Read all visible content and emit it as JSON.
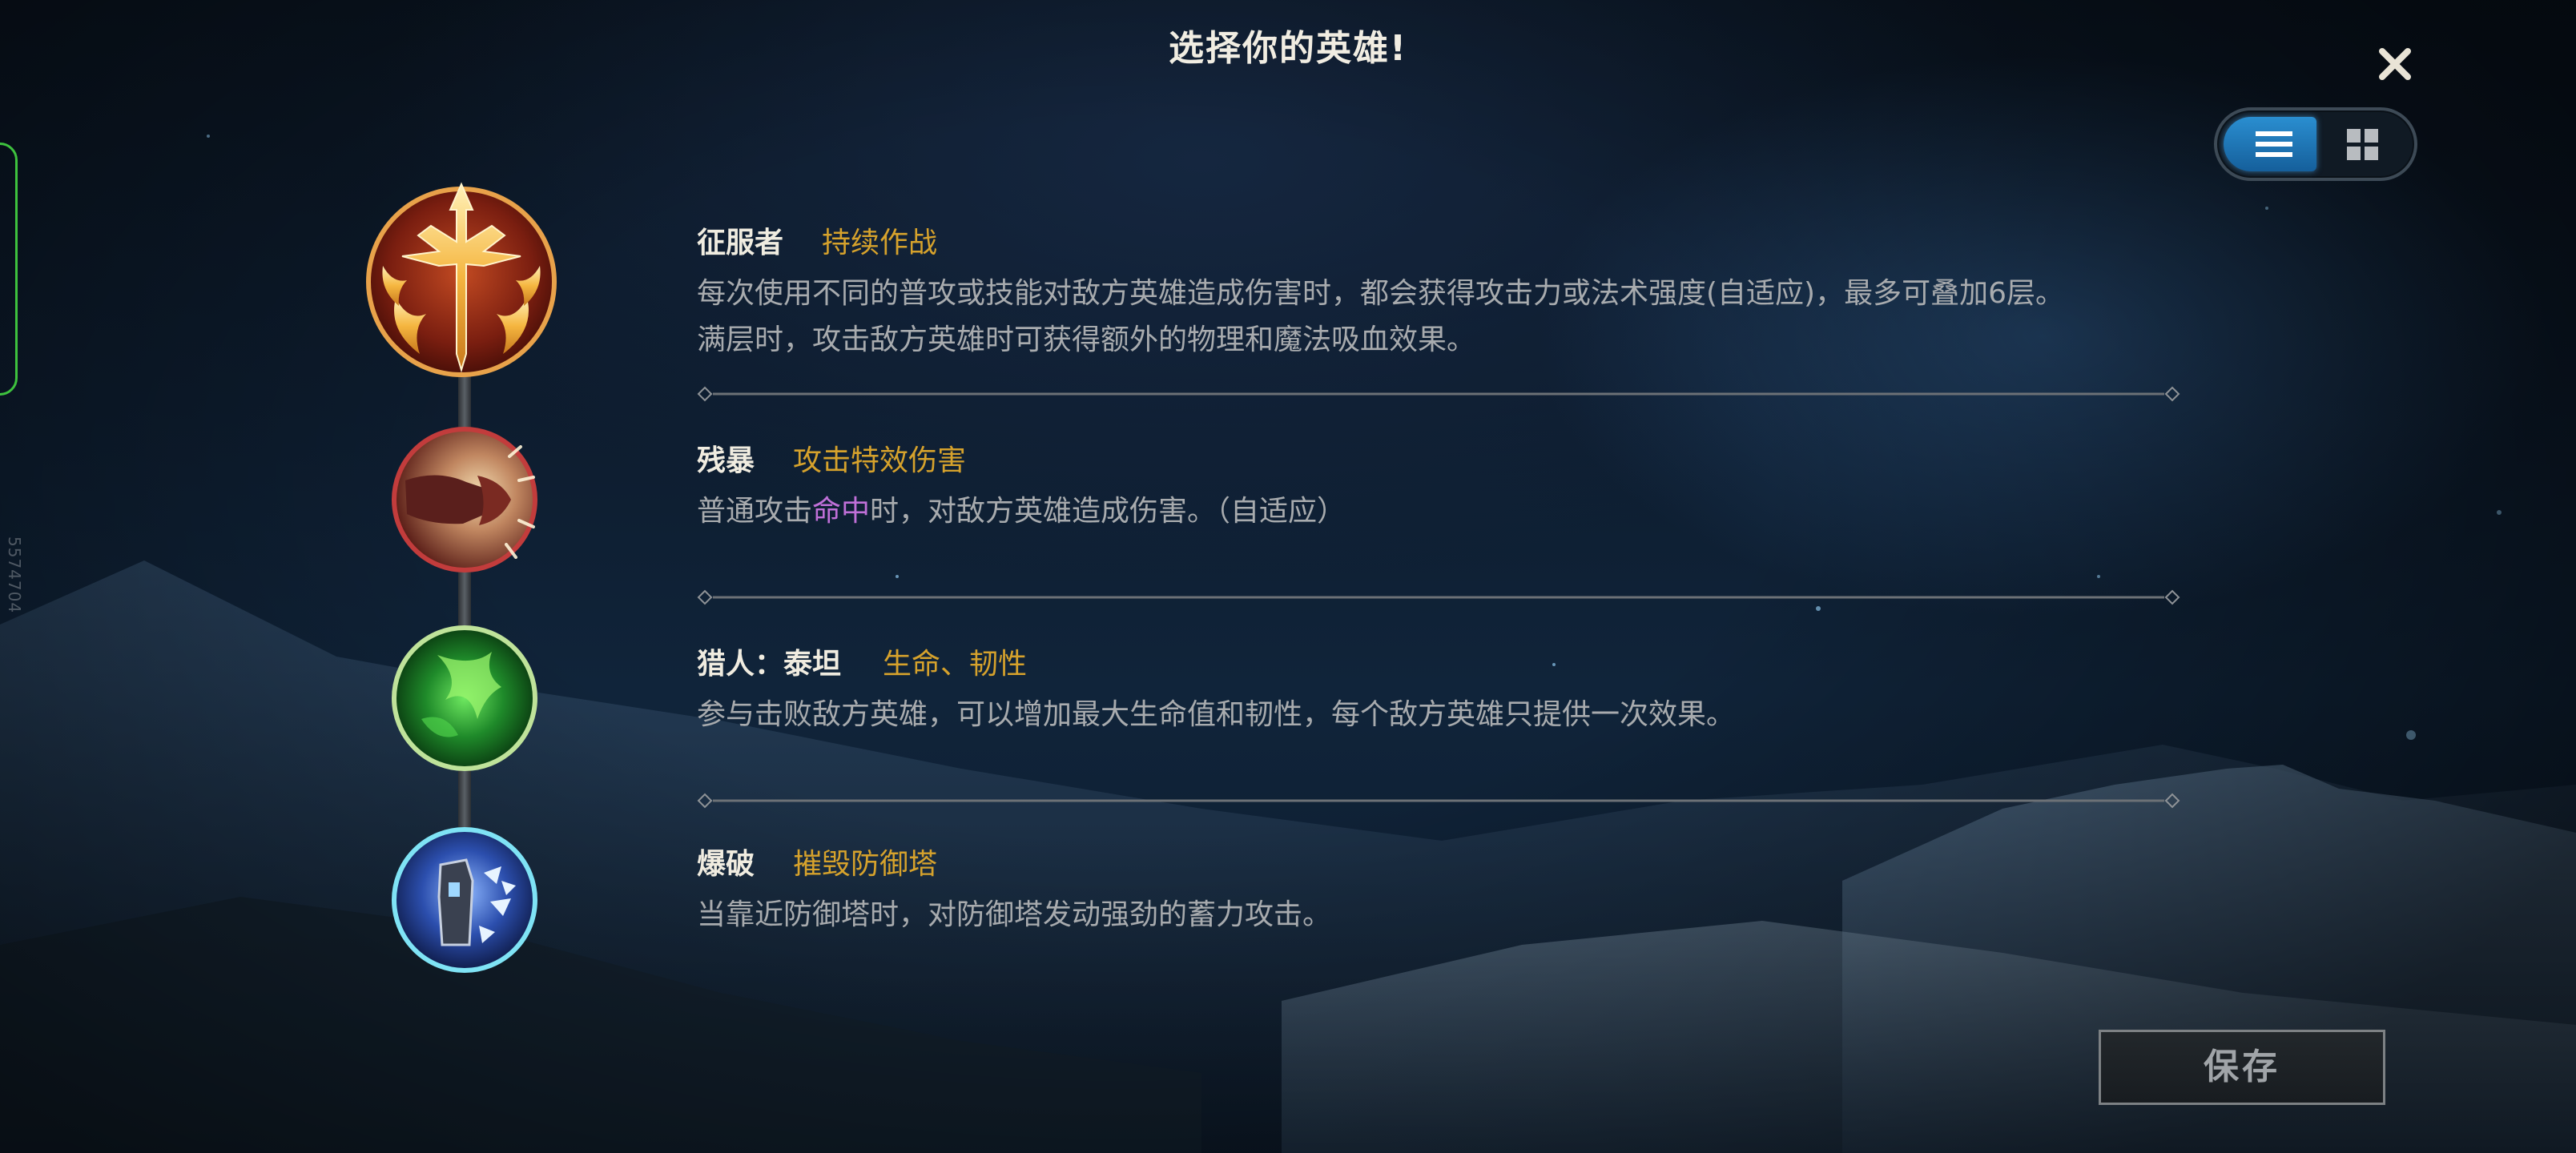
{
  "page": {
    "title": "选择你的英雄!",
    "side_id": "5574704"
  },
  "toolbar": {
    "close_icon": "close-icon",
    "view_modes": [
      {
        "name": "list",
        "icon": "list-icon",
        "active": true
      },
      {
        "name": "grid",
        "icon": "grid-icon",
        "active": false
      }
    ],
    "accent_color": "#2a8ed0"
  },
  "runes": [
    {
      "name": "征服者",
      "tag": "持续作战",
      "icon": "conqueror-icon",
      "desc_lines": [
        "每次使用不同的普攻或技能对敌方英雄造成伤害时，都会获得攻击力或法术强度(自适应)，最多可叠加6层。",
        "满层时，攻击敌方英雄时可获得额外的物理和魔法吸血效果。"
      ]
    },
    {
      "name": "残暴",
      "tag": "攻击特效伤害",
      "icon": "brutal-strike-icon",
      "desc_before": "普通攻击",
      "desc_highlight": "命中",
      "desc_after": "时，对敌方英雄造成伤害。（自适应）"
    },
    {
      "name": "猎人：泰坦",
      "tag": "生命、韧性",
      "icon": "titan-hunter-icon",
      "desc": "参与击败敌方英雄，可以增加最大生命值和韧性，每个敌方英雄只提供一次效果。"
    },
    {
      "name": "爆破",
      "tag": "摧毁防御塔",
      "icon": "demolish-icon",
      "desc": "当靠近防御塔时，对防御塔发动强劲的蓄力攻击。"
    }
  ],
  "colors": {
    "name": "#f0ece0",
    "tag": "#d6a22c",
    "desc": "#a8abae",
    "highlight": "#c070d8"
  },
  "save_label": "保存"
}
